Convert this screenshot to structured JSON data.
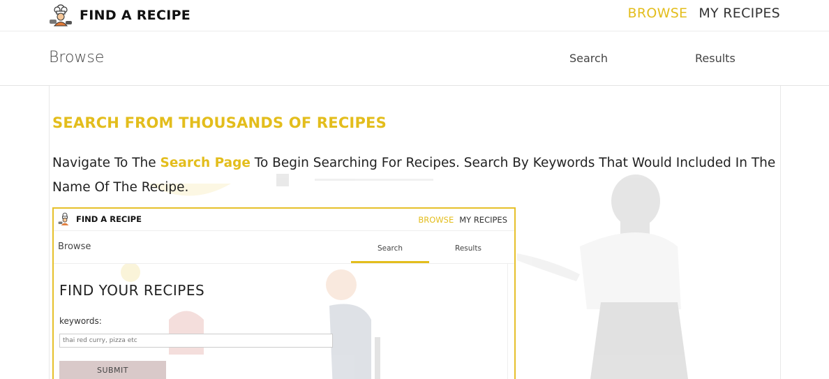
{
  "header": {
    "brand": "FIND A RECIPE",
    "logo_icon": "chef-icon",
    "nav": [
      {
        "label": "BROWSE",
        "active": true
      },
      {
        "label": "MY RECIPES",
        "active": false
      }
    ]
  },
  "subheader": {
    "title": "Browse",
    "tabs": [
      {
        "label": "Search"
      },
      {
        "label": "Results"
      }
    ]
  },
  "main": {
    "headline": "SEARCH FROM THOUSANDS OF RECIPES",
    "description": {
      "before": "Navigate To The ",
      "highlight": "Search Page",
      "after": " To Begin Searching For Recipes. Search By Keywords That Would Included In The Name Of The Recipe."
    }
  },
  "preview": {
    "brand": "FIND A RECIPE",
    "nav": [
      {
        "label": "BROWSE",
        "active": true
      },
      {
        "label": "MY RECIPES",
        "active": false
      }
    ],
    "sub_title": "Browse",
    "tabs": [
      {
        "label": "Search",
        "active": true
      },
      {
        "label": "Results",
        "active": false
      }
    ],
    "heading": "FIND YOUR RECIPES",
    "keywords_label": "keywords:",
    "input_placeholder": "thai red curry, pizza etc",
    "submit_label": "SUBMIT"
  },
  "colors": {
    "accent": "#e3bd1c",
    "text": "#222222",
    "submit_bg": "#d9c9c9"
  }
}
